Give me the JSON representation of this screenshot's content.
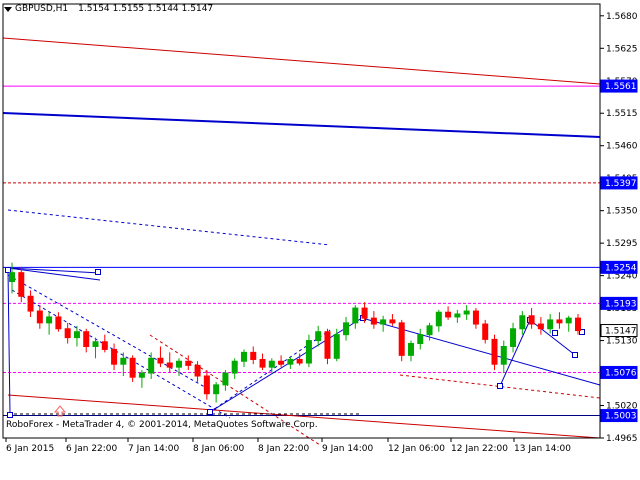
{
  "header": {
    "symbol": "GBPUSD,H1",
    "open": "1.5154",
    "high": "1.5155",
    "low": "1.5144",
    "close": "1.5147"
  },
  "footer": {
    "copyright": "RoboForex - MetaTrader 4, © 2001-2014, MetaQuotes Software Corp."
  },
  "colors": {
    "candle_up": "#00aa00",
    "candle_down": "#ff0000",
    "forecast_line": "#0000ff",
    "level_line_magenta": "#ff00ff",
    "level_line_dark_red": "#cc0000",
    "price_label_bg": "#0000ff"
  },
  "chart_data": {
    "type": "candlestick",
    "symbol": "GBPUSD",
    "timeframe": "H1",
    "ylim": [
      1.4965,
      1.57
    ],
    "y_ticks": [
      "1.5680",
      "1.5625",
      "1.5570",
      "1.5515",
      "1.5460",
      "1.5405",
      "1.5350",
      "1.5295",
      "1.5240",
      "1.5185",
      "1.5130",
      "1.5075",
      "1.5020",
      "1.4965"
    ],
    "y_tick_values": [
      1.568,
      1.5625,
      1.557,
      1.5515,
      1.546,
      1.5405,
      1.535,
      1.5295,
      1.524,
      1.5185,
      1.513,
      1.5075,
      1.502,
      1.4965
    ],
    "x_labels": [
      "6 Jan 2015",
      "6 Jan 22:00",
      "7 Jan 14:00",
      "8 Jan 06:00",
      "8 Jan 22:00",
      "9 Jan 14:00",
      "12 Jan 06:00",
      "12 Jan 22:00",
      "13 Jan 14:00"
    ],
    "price_labels": [
      {
        "text": "1.5561",
        "value": 1.5561
      },
      {
        "text": "1.5397",
        "value": 1.5397
      },
      {
        "text": "1.5254",
        "value": 1.5254
      },
      {
        "text": "1.5193",
        "value": 1.5193
      },
      {
        "text": "1.5147",
        "value": 1.5147,
        "current": true
      },
      {
        "text": "1.5076",
        "value": 1.5076
      },
      {
        "text": "1.5003",
        "value": 1.5003
      }
    ],
    "horizontal_levels": [
      {
        "value": 1.5561,
        "style": "solid",
        "color": "#ff00ff"
      },
      {
        "value": 1.5397,
        "style": "dashed",
        "color": "#cc0000"
      },
      {
        "value": 1.5254,
        "style": "solid",
        "color": "#0000ff"
      },
      {
        "value": 1.5193,
        "style": "dashed",
        "color": "#ff00ff"
      },
      {
        "value": 1.5076,
        "style": "dashed",
        "color": "#ff00ff"
      },
      {
        "value": 1.5003,
        "style": "solid",
        "color": "#000080"
      }
    ],
    "candles": [
      {
        "o": 1.523,
        "h": 1.5262,
        "l": 1.521,
        "c": 1.5245
      },
      {
        "o": 1.5245,
        "h": 1.5255,
        "l": 1.5195,
        "c": 1.5205
      },
      {
        "o": 1.5205,
        "h": 1.5215,
        "l": 1.517,
        "c": 1.518
      },
      {
        "o": 1.518,
        "h": 1.519,
        "l": 1.515,
        "c": 1.516
      },
      {
        "o": 1.516,
        "h": 1.518,
        "l": 1.514,
        "c": 1.517
      },
      {
        "o": 1.517,
        "h": 1.5178,
        "l": 1.5145,
        "c": 1.515
      },
      {
        "o": 1.515,
        "h": 1.516,
        "l": 1.5125,
        "c": 1.5135
      },
      {
        "o": 1.5135,
        "h": 1.5155,
        "l": 1.512,
        "c": 1.5145
      },
      {
        "o": 1.5145,
        "h": 1.515,
        "l": 1.511,
        "c": 1.512
      },
      {
        "o": 1.512,
        "h": 1.5135,
        "l": 1.51,
        "c": 1.5128
      },
      {
        "o": 1.5128,
        "h": 1.514,
        "l": 1.511,
        "c": 1.5115
      },
      {
        "o": 1.5115,
        "h": 1.5125,
        "l": 1.508,
        "c": 1.509
      },
      {
        "o": 1.509,
        "h": 1.511,
        "l": 1.507,
        "c": 1.51
      },
      {
        "o": 1.51,
        "h": 1.5105,
        "l": 1.506,
        "c": 1.5068
      },
      {
        "o": 1.5068,
        "h": 1.508,
        "l": 1.505,
        "c": 1.5075
      },
      {
        "o": 1.5075,
        "h": 1.511,
        "l": 1.5065,
        "c": 1.51
      },
      {
        "o": 1.51,
        "h": 1.512,
        "l": 1.5085,
        "c": 1.5092
      },
      {
        "o": 1.5092,
        "h": 1.511,
        "l": 1.5075,
        "c": 1.5085
      },
      {
        "o": 1.5085,
        "h": 1.51,
        "l": 1.507,
        "c": 1.5095
      },
      {
        "o": 1.5095,
        "h": 1.5105,
        "l": 1.508,
        "c": 1.5088
      },
      {
        "o": 1.5088,
        "h": 1.5095,
        "l": 1.506,
        "c": 1.507
      },
      {
        "o": 1.507,
        "h": 1.508,
        "l": 1.503,
        "c": 1.504
      },
      {
        "o": 1.504,
        "h": 1.506,
        "l": 1.5025,
        "c": 1.5055
      },
      {
        "o": 1.5055,
        "h": 1.508,
        "l": 1.5045,
        "c": 1.5075
      },
      {
        "o": 1.5075,
        "h": 1.51,
        "l": 1.5065,
        "c": 1.5095
      },
      {
        "o": 1.5095,
        "h": 1.5115,
        "l": 1.5085,
        "c": 1.511
      },
      {
        "o": 1.511,
        "h": 1.512,
        "l": 1.509,
        "c": 1.5098
      },
      {
        "o": 1.5098,
        "h": 1.5108,
        "l": 1.508,
        "c": 1.5085
      },
      {
        "o": 1.5085,
        "h": 1.51,
        "l": 1.5075,
        "c": 1.5095
      },
      {
        "o": 1.5095,
        "h": 1.5105,
        "l": 1.5085,
        "c": 1.509
      },
      {
        "o": 1.509,
        "h": 1.5102,
        "l": 1.5082,
        "c": 1.5098
      },
      {
        "o": 1.5098,
        "h": 1.5108,
        "l": 1.5088,
        "c": 1.5092
      },
      {
        "o": 1.5092,
        "h": 1.514,
        "l": 1.5085,
        "c": 1.513
      },
      {
        "o": 1.513,
        "h": 1.5155,
        "l": 1.512,
        "c": 1.5145
      },
      {
        "o": 1.5145,
        "h": 1.515,
        "l": 1.509,
        "c": 1.51
      },
      {
        "o": 1.51,
        "h": 1.515,
        "l": 1.5095,
        "c": 1.514
      },
      {
        "o": 1.514,
        "h": 1.517,
        "l": 1.513,
        "c": 1.516
      },
      {
        "o": 1.516,
        "h": 1.519,
        "l": 1.515,
        "c": 1.5185
      },
      {
        "o": 1.5185,
        "h": 1.5195,
        "l": 1.516,
        "c": 1.5168
      },
      {
        "o": 1.5168,
        "h": 1.518,
        "l": 1.515,
        "c": 1.5158
      },
      {
        "o": 1.5158,
        "h": 1.5172,
        "l": 1.5145,
        "c": 1.5165
      },
      {
        "o": 1.5165,
        "h": 1.5175,
        "l": 1.5155,
        "c": 1.516
      },
      {
        "o": 1.516,
        "h": 1.5165,
        "l": 1.5095,
        "c": 1.5105
      },
      {
        "o": 1.5105,
        "h": 1.513,
        "l": 1.5095,
        "c": 1.5125
      },
      {
        "o": 1.5125,
        "h": 1.515,
        "l": 1.5115,
        "c": 1.514
      },
      {
        "o": 1.514,
        "h": 1.516,
        "l": 1.513,
        "c": 1.5155
      },
      {
        "o": 1.5155,
        "h": 1.5182,
        "l": 1.5145,
        "c": 1.5178
      },
      {
        "o": 1.5178,
        "h": 1.5188,
        "l": 1.5165,
        "c": 1.517
      },
      {
        "o": 1.517,
        "h": 1.5182,
        "l": 1.516,
        "c": 1.5175
      },
      {
        "o": 1.5175,
        "h": 1.519,
        "l": 1.5165,
        "c": 1.518
      },
      {
        "o": 1.518,
        "h": 1.5185,
        "l": 1.515,
        "c": 1.5158
      },
      {
        "o": 1.5158,
        "h": 1.5165,
        "l": 1.5125,
        "c": 1.5132
      },
      {
        "o": 1.5132,
        "h": 1.514,
        "l": 1.508,
        "c": 1.509
      },
      {
        "o": 1.509,
        "h": 1.513,
        "l": 1.5075,
        "c": 1.512
      },
      {
        "o": 1.512,
        "h": 1.516,
        "l": 1.511,
        "c": 1.515
      },
      {
        "o": 1.515,
        "h": 1.518,
        "l": 1.514,
        "c": 1.5172
      },
      {
        "o": 1.5172,
        "h": 1.5185,
        "l": 1.515,
        "c": 1.5158
      },
      {
        "o": 1.5158,
        "h": 1.517,
        "l": 1.514,
        "c": 1.515
      },
      {
        "o": 1.515,
        "h": 1.5175,
        "l": 1.5142,
        "c": 1.5165
      },
      {
        "o": 1.5165,
        "h": 1.5178,
        "l": 1.515,
        "c": 1.516
      },
      {
        "o": 1.516,
        "h": 1.5172,
        "l": 1.5145,
        "c": 1.5168
      },
      {
        "o": 1.5168,
        "h": 1.5175,
        "l": 1.514,
        "c": 1.5147
      }
    ]
  }
}
